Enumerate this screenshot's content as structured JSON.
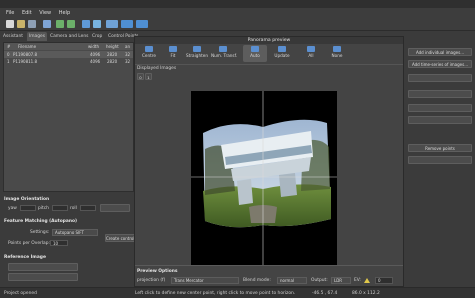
{
  "menu": [
    "File",
    "Edit",
    "View",
    "Help"
  ],
  "tabs": [
    "Assistant",
    "Images",
    "Camera and Lens",
    "Crop",
    "Control Points"
  ],
  "image_list": {
    "headers": [
      "#",
      "Filename",
      "width",
      "height",
      "an"
    ],
    "rows": [
      {
        "num": "0",
        "filename": "P1190807.8",
        "width": "4096",
        "height": "2820",
        "an": "32"
      },
      {
        "num": "1",
        "filename": "P1190811.8",
        "width": "4096",
        "height": "2820",
        "an": "32"
      }
    ]
  },
  "image_orientation": {
    "title": "Image Orientation",
    "yaw_label": "yaw",
    "pitch_label": "pitch",
    "roll_label": "roll"
  },
  "feature_matching": {
    "title": "Feature Matching (Autopano)",
    "settings_label": "Settings:",
    "settings_value": "Autopano SIFT",
    "points_label": "Points per Overlap:",
    "points_value": "10",
    "create_button": "Create control"
  },
  "reference_image": {
    "title": "Reference Image"
  },
  "right_panel": {
    "add_individual": "Add individual images...",
    "add_time_series": "Add time-series of images...",
    "remove_points": "Remove points"
  },
  "preview": {
    "title": "Panorama preview",
    "tools": [
      {
        "label": "Centre",
        "icon": "centre-icon"
      },
      {
        "label": "Fit",
        "icon": "fit-icon"
      },
      {
        "label": "Straighten",
        "icon": "straighten-icon"
      },
      {
        "label": "Num. Transf.",
        "icon": "num-transform-icon"
      },
      {
        "label": "Auto",
        "icon": "auto-icon",
        "active": true
      },
      {
        "label": "Update",
        "icon": "update-icon"
      },
      {
        "label": "All",
        "icon": "all-icon"
      },
      {
        "label": "None",
        "icon": "none-icon"
      }
    ],
    "displayed_images_label": "Displayed Images",
    "displayed_images": [
      "0",
      "1"
    ],
    "options_title": "Preview Options",
    "projection_label": "projection (f)",
    "projection_value": "Trans Mercator",
    "blend_label": "Blend mode:",
    "blend_value": "normal",
    "output_label": "Output:",
    "output_value": "LDR",
    "ev_label": "EV:",
    "ev_value": "0"
  },
  "status": {
    "left": "Project opened",
    "hint": "Left click to define new center point, right click to move point to horizon.",
    "coords": "-46.5 , 67.4",
    "fov": "86.0 x 112.2"
  }
}
